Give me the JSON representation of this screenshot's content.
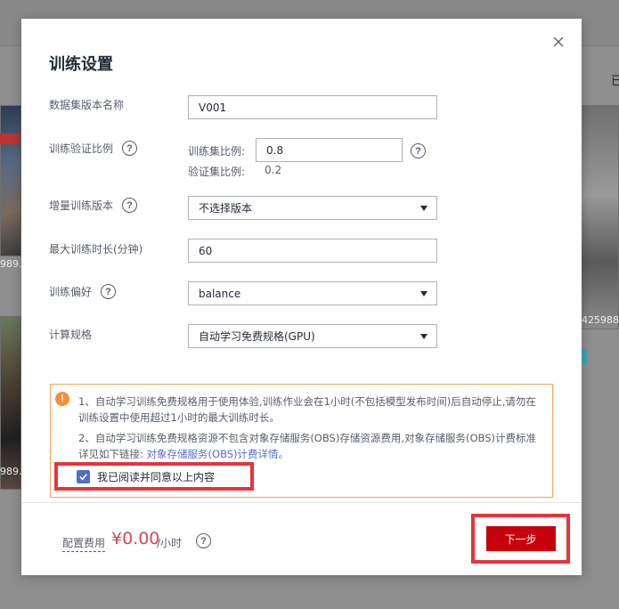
{
  "background": {
    "right_text": "已",
    "labels": [
      "989...",
      "989...",
      "425988"
    ]
  },
  "dialog": {
    "title": "训练设置",
    "close_glyph": "×",
    "dataset_version": {
      "label": "数据集版本名称",
      "value": "V001"
    },
    "split_ratio": {
      "label": "训练验证比例",
      "train_label": "训练集比例:",
      "train_value": "0.8",
      "val_label": "验证集比例:",
      "val_value": "0.2"
    },
    "incremental_version": {
      "label": "增量训练版本",
      "selected": "不选择版本"
    },
    "max_duration": {
      "label": "最大训练时长(分钟)",
      "value": "60"
    },
    "preference": {
      "label": "训练偏好",
      "selected": "balance"
    },
    "compute_spec": {
      "label": "计算规格",
      "selected": "自动学习免费规格(GPU)"
    },
    "notice": {
      "line1": "1、自动学习训练免费规格用于使用体验,训练作业会在1小时(不包括模型发布时间)后自动停止,请勿在训练设置中使用超过1小时的最大训练时长。",
      "line2_prefix": "2、自动学习训练免费规格资源不包含对象存储服务(OBS)存储资源费用,对象存储服务(OBS)计费标准详见如下链接:",
      "line2_link": "对象存储服务(OBS)计费详情。",
      "agree_label": "我已阅读并同意以上内容",
      "agree_checked": true
    },
    "footer": {
      "fee_label": "配置费用",
      "fee_price": "¥0.00",
      "fee_unit": "/小时",
      "next_label": "下一步"
    }
  },
  "colors": {
    "accent": "#526ecc",
    "primary_button": "#c7000b",
    "warning": "#f58e3a",
    "highlight": "#e8333a",
    "price": "#d64a52"
  },
  "icons": [
    "close-icon",
    "help-icon",
    "warning-icon",
    "checkmark-icon",
    "chevron-down-icon"
  ]
}
